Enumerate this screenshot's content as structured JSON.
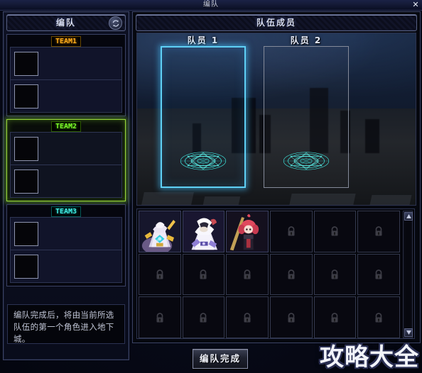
{
  "window": {
    "title": "编队",
    "close_label": "✕"
  },
  "left_panel": {
    "header": "编队",
    "refresh_icon": "refresh-icon",
    "teams": [
      {
        "badge": "TEAM1",
        "color": "#ffae1c",
        "selected": false,
        "slots": [
          {
            "empty": true
          },
          {
            "empty": true
          }
        ]
      },
      {
        "badge": "TEAM2",
        "color": "#7cfb2c",
        "selected": true,
        "slots": [
          {
            "empty": true
          },
          {
            "empty": true
          }
        ]
      },
      {
        "badge": "TEAM3",
        "color": "#44f2e7",
        "selected": false,
        "slots": [
          {
            "empty": true
          },
          {
            "empty": true
          }
        ]
      }
    ],
    "hint": "编队完成后，将由当前所选队伍的第一个角色进入地下城。"
  },
  "right_panel": {
    "header": "队伍成员",
    "members": [
      {
        "title": "队员 1",
        "active": true,
        "magic_circle": "magic-circle-icon"
      },
      {
        "title": "队员 2",
        "active": false,
        "magic_circle": "magic-circle-icon"
      }
    ],
    "grid": {
      "columns": 6,
      "rows": 3,
      "cells": [
        {
          "filled": true,
          "character": "white-gold-knight",
          "lock_icon": null
        },
        {
          "filled": true,
          "character": "white-haired-mage",
          "lock_icon": null
        },
        {
          "filled": true,
          "character": "red-haired-staff-user",
          "lock_icon": null
        },
        {
          "filled": false,
          "character": null,
          "lock_icon": "lock-icon"
        },
        {
          "filled": false,
          "character": null,
          "lock_icon": "lock-icon"
        },
        {
          "filled": false,
          "character": null,
          "lock_icon": "lock-icon"
        },
        {
          "filled": false,
          "character": null,
          "lock_icon": "lock-icon"
        },
        {
          "filled": false,
          "character": null,
          "lock_icon": "lock-icon"
        },
        {
          "filled": false,
          "character": null,
          "lock_icon": "lock-icon"
        },
        {
          "filled": false,
          "character": null,
          "lock_icon": "lock-icon"
        },
        {
          "filled": false,
          "character": null,
          "lock_icon": "lock-icon"
        },
        {
          "filled": false,
          "character": null,
          "lock_icon": "lock-icon"
        },
        {
          "filled": false,
          "character": null,
          "lock_icon": "lock-icon"
        },
        {
          "filled": false,
          "character": null,
          "lock_icon": "lock-icon"
        },
        {
          "filled": false,
          "character": null,
          "lock_icon": "lock-icon"
        },
        {
          "filled": false,
          "character": null,
          "lock_icon": "lock-icon"
        },
        {
          "filled": false,
          "character": null,
          "lock_icon": "lock-icon"
        },
        {
          "filled": false,
          "character": null,
          "lock_icon": "lock-icon"
        }
      ]
    },
    "scrollbar": {
      "up_icon": "scroll-up-icon",
      "down_icon": "scroll-down-icon"
    }
  },
  "footer": {
    "confirm_label": "编队完成"
  },
  "watermark": {
    "text": "攻略大全"
  },
  "colors": {
    "accent_cyan": "#5fd0f5",
    "team1": "#ffae1c",
    "team2": "#7cfb2c",
    "team3": "#44f2e7",
    "panel_border": "#3b4365",
    "bg": "#06080f"
  }
}
